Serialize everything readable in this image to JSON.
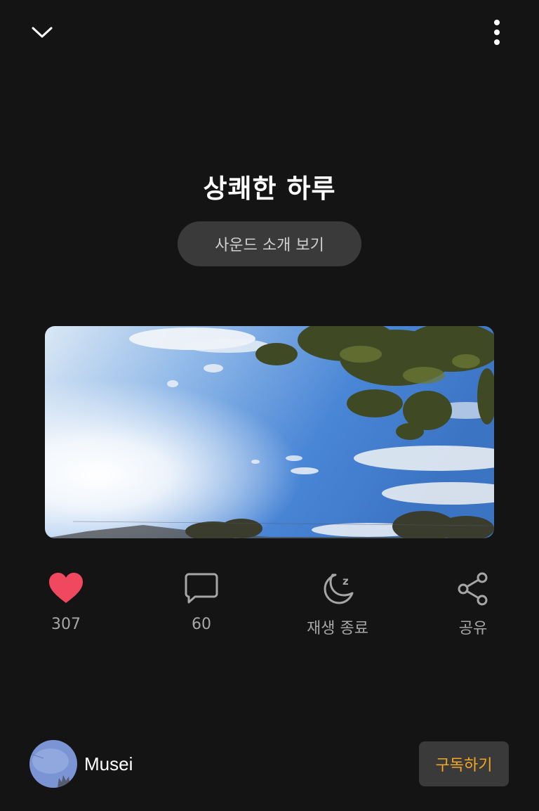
{
  "header": {
    "collapse_icon": "chevron-down-icon",
    "more_icon": "more-vertical-icon"
  },
  "sound": {
    "title": "상쾌한 하루",
    "intro_button": "사운드 소개 보기"
  },
  "actions": {
    "like": {
      "icon": "heart-icon",
      "label": "307",
      "color": "#f0485e"
    },
    "comment": {
      "icon": "comment-icon",
      "label": "60"
    },
    "sleep_timer": {
      "icon": "moon-sleep-icon",
      "label": "재생 종료"
    },
    "share": {
      "icon": "share-icon",
      "label": "공유"
    }
  },
  "creator": {
    "name": "Musei",
    "subscribe_label": "구독하기",
    "subscribe_color": "#f5a623"
  }
}
